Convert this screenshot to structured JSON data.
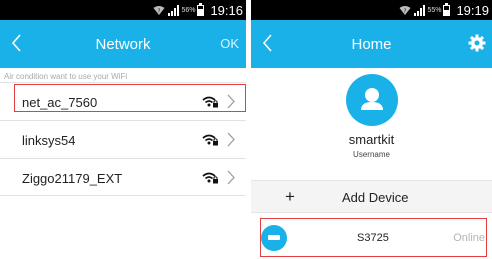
{
  "left_screen": {
    "status": {
      "battery_percent": "56%",
      "time": "19:16"
    },
    "nav": {
      "title": "Network",
      "right_action": "OK"
    },
    "hint": "Air condition want to use your WiFi",
    "networks": [
      {
        "name": "net_ac_7560",
        "secured": true,
        "selected": true
      },
      {
        "name": "linksys54",
        "secured": true,
        "selected": false
      },
      {
        "name": "Ziggo21179_EXT",
        "secured": true,
        "selected": false
      }
    ]
  },
  "right_screen": {
    "status": {
      "battery_percent": "55%",
      "time": "19:19"
    },
    "nav": {
      "title": "Home"
    },
    "profile": {
      "name": "smartkit",
      "subtitle": "Username"
    },
    "add_device_label": "Add Device",
    "devices": [
      {
        "name": "S3725",
        "status": "Online",
        "selected": true
      }
    ]
  },
  "colors": {
    "accent": "#1ab0e8",
    "highlight_outline": "#e0403f",
    "status_bar": "#000000"
  },
  "icons": [
    "wifi-status-icon",
    "signal-icon",
    "battery-icon",
    "back-arrow-icon",
    "settings-gear-icon",
    "wifi-lock-icon",
    "chevron-right-icon",
    "user-avatar-icon",
    "plus-icon",
    "device-icon"
  ]
}
